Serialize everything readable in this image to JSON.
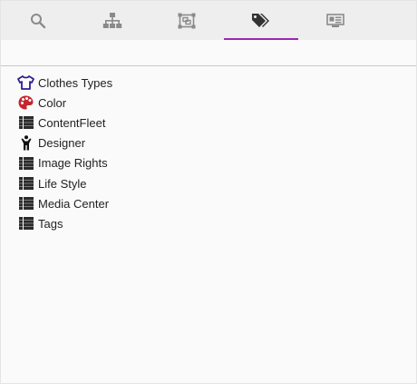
{
  "tabs": [
    {
      "icon": "search-icon",
      "active": false
    },
    {
      "icon": "sitemap-icon",
      "active": false
    },
    {
      "icon": "object-group-icon",
      "active": false
    },
    {
      "icon": "tags-icon",
      "active": true
    },
    {
      "icon": "id-card-icon",
      "active": false
    }
  ],
  "colors": {
    "tab_icon": "#8a8a8a",
    "tab_icon_active": "#333333",
    "active_underline": "#9c27b0",
    "clothes_icon": "#2d1f8f",
    "color_icon": "#c6262e",
    "list_icon": "#2b2b2b"
  },
  "categories": [
    {
      "label": "Clothes Types",
      "icon": "shirt-icon"
    },
    {
      "label": "Color",
      "icon": "palette-icon"
    },
    {
      "label": "ContentFleet",
      "icon": "list-icon"
    },
    {
      "label": "Designer",
      "icon": "person-icon"
    },
    {
      "label": "Image Rights",
      "icon": "list-icon"
    },
    {
      "label": "Life Style",
      "icon": "list-icon"
    },
    {
      "label": "Media Center",
      "icon": "list-icon"
    },
    {
      "label": "Tags",
      "icon": "list-icon"
    }
  ]
}
